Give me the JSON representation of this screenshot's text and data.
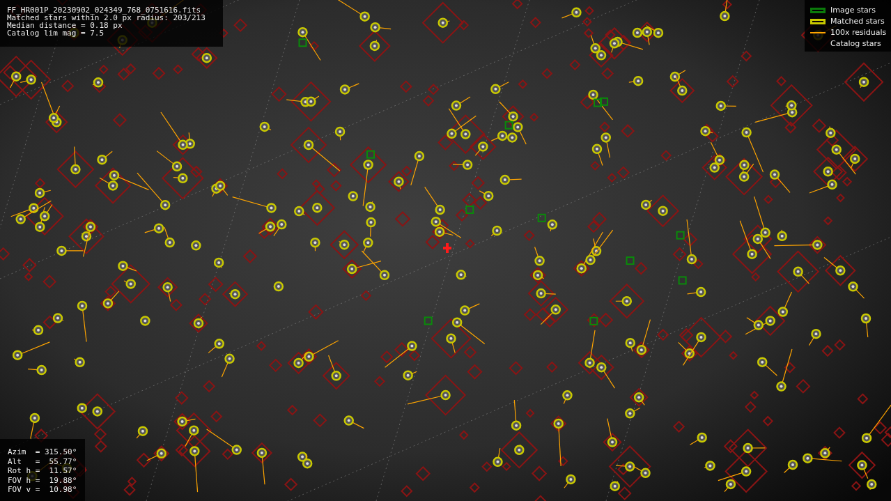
{
  "header": {
    "lines": [
      "FF_HR001P_20230902_024349_768_0751616.fits",
      "Matched stars within 2.0 px radius: 203/213",
      "Median distance = 0.18 px",
      "Catalog lim mag = 7.5"
    ]
  },
  "legend": [
    {
      "kind": "image",
      "label": "Image stars"
    },
    {
      "kind": "matched",
      "label": "Matched stars"
    },
    {
      "kind": "residual",
      "label": "100x residuals"
    },
    {
      "kind": "catalog",
      "label": "Catalog stars"
    }
  ],
  "pointing": [
    "Azim  = 315.50°",
    "Alt   =  55.77°",
    "Rot h =  11.57°",
    "FOV h =  19.88°",
    "FOV v =  10.98°"
  ]
}
